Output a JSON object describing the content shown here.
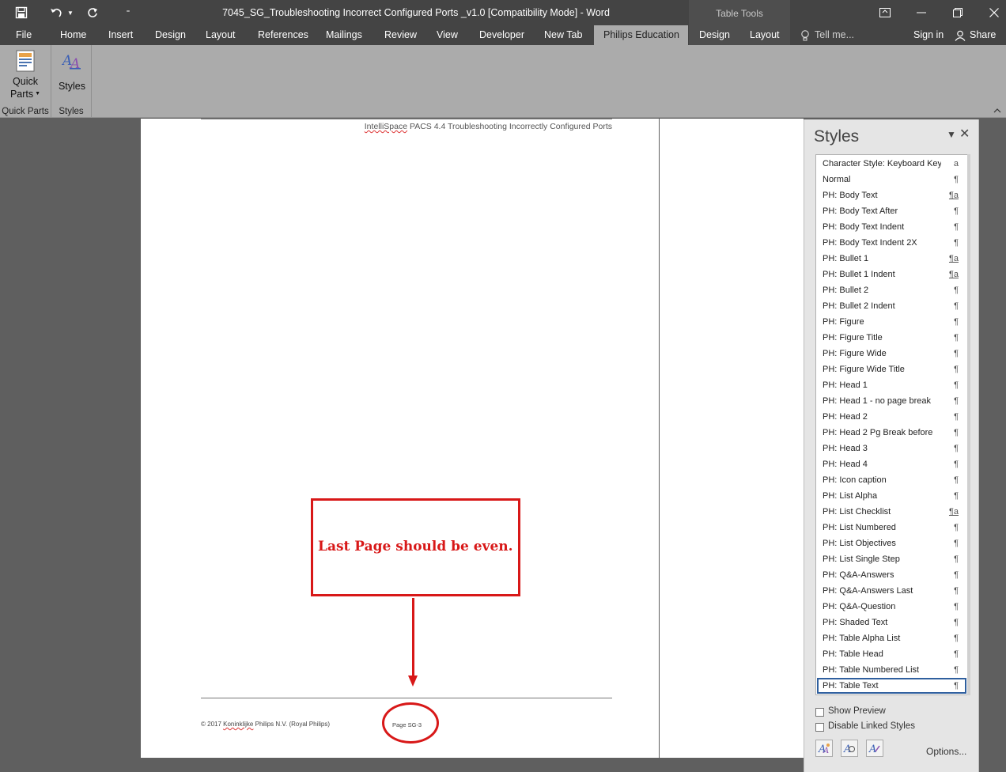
{
  "window": {
    "title": "7045_SG_Troubleshooting Incorrect Configured Ports _v1.0 [Compatibility Mode] - Word",
    "table_tools": "Table Tools"
  },
  "qat": {
    "save_icon": "save-icon",
    "undo_icon": "undo-icon",
    "redo_icon": "redo-icon",
    "customize_icon": "customize-icon"
  },
  "tabs": {
    "file": "File",
    "home": "Home",
    "insert": "Insert",
    "design": "Design",
    "layout": "Layout",
    "references": "References",
    "mailings": "Mailings",
    "review": "Review",
    "view": "View",
    "developer": "Developer",
    "new_tab": "New Tab",
    "philips_education": "Philips Education",
    "tt_design": "Design",
    "tt_layout": "Layout",
    "tell_me": "Tell me...",
    "sign_in": "Sign in",
    "share": "Share"
  },
  "ribbon": {
    "quick_parts_line1": "Quick",
    "quick_parts_line2": "Parts",
    "quick_parts_group": "Quick Parts",
    "styles_button": "Styles",
    "styles_group": "Styles"
  },
  "document": {
    "header_brand": "IntelliSpace",
    "header_rest": " PACS 4.4  Troubleshooting Incorrectly Configured Ports",
    "footer_copy_pre": "© 2017 ",
    "footer_copy_brand": "Koninklijke",
    "footer_copy_post": " Philips N.V. (Royal Philips)",
    "footer_page": "Page SG-3",
    "callout": "Last Page should be even."
  },
  "styles_pane": {
    "title": "Styles",
    "items": [
      {
        "label": "Character Style: Keyboard Key",
        "sym": "a",
        "linked": false
      },
      {
        "label": "Normal",
        "sym": "¶",
        "linked": false
      },
      {
        "label": "PH: Body Text",
        "sym": "¶a",
        "linked": true
      },
      {
        "label": "PH: Body Text After",
        "sym": "¶",
        "linked": false
      },
      {
        "label": "PH: Body Text Indent",
        "sym": "¶",
        "linked": false
      },
      {
        "label": "PH: Body Text Indent 2X",
        "sym": "¶",
        "linked": false
      },
      {
        "label": "PH: Bullet 1",
        "sym": "¶a",
        "linked": true
      },
      {
        "label": "PH: Bullet 1 Indent",
        "sym": "¶a",
        "linked": true
      },
      {
        "label": "PH: Bullet 2",
        "sym": "¶",
        "linked": false
      },
      {
        "label": "PH: Bullet 2 Indent",
        "sym": "¶",
        "linked": false
      },
      {
        "label": "PH: Figure",
        "sym": "¶",
        "linked": false
      },
      {
        "label": "PH: Figure Title",
        "sym": "¶",
        "linked": false
      },
      {
        "label": "PH: Figure Wide",
        "sym": "¶",
        "linked": false
      },
      {
        "label": "PH: Figure Wide Title",
        "sym": "¶",
        "linked": false
      },
      {
        "label": "PH: Head 1",
        "sym": "¶",
        "linked": false
      },
      {
        "label": "PH: Head 1 - no page break",
        "sym": "¶",
        "linked": false
      },
      {
        "label": "PH: Head 2",
        "sym": "¶",
        "linked": false
      },
      {
        "label": "PH: Head 2 Pg Break before",
        "sym": "¶",
        "linked": false
      },
      {
        "label": "PH: Head 3",
        "sym": "¶",
        "linked": false
      },
      {
        "label": "PH: Head 4",
        "sym": "¶",
        "linked": false
      },
      {
        "label": "PH: Icon caption",
        "sym": "¶",
        "linked": false
      },
      {
        "label": "PH: List Alpha",
        "sym": "¶",
        "linked": false
      },
      {
        "label": "PH: List Checklist",
        "sym": "¶a",
        "linked": true
      },
      {
        "label": "PH: List Numbered",
        "sym": "¶",
        "linked": false
      },
      {
        "label": "PH: List Objectives",
        "sym": "¶",
        "linked": false
      },
      {
        "label": "PH: List Single Step",
        "sym": "¶",
        "linked": false
      },
      {
        "label": "PH: Q&A-Answers",
        "sym": "¶",
        "linked": false
      },
      {
        "label": "PH: Q&A-Answers Last",
        "sym": "¶",
        "linked": false
      },
      {
        "label": "PH: Q&A-Question",
        "sym": "¶",
        "linked": false
      },
      {
        "label": "PH: Shaded Text",
        "sym": "¶",
        "linked": false
      },
      {
        "label": "PH: Table Alpha List",
        "sym": "¶",
        "linked": false
      },
      {
        "label": "PH: Table Head",
        "sym": "¶",
        "linked": false
      },
      {
        "label": "PH: Table Numbered List",
        "sym": "¶",
        "linked": false
      },
      {
        "label": "PH: Table Text",
        "sym": "¶",
        "linked": false
      }
    ],
    "selected_index": 33,
    "show_preview": "Show Preview",
    "disable_linked": "Disable Linked Styles",
    "options": "Options..."
  },
  "colors": {
    "accent": "#d81818",
    "ribbon": "#ababab",
    "titlebar": "#444444",
    "selected_border": "#2f5f9e"
  }
}
